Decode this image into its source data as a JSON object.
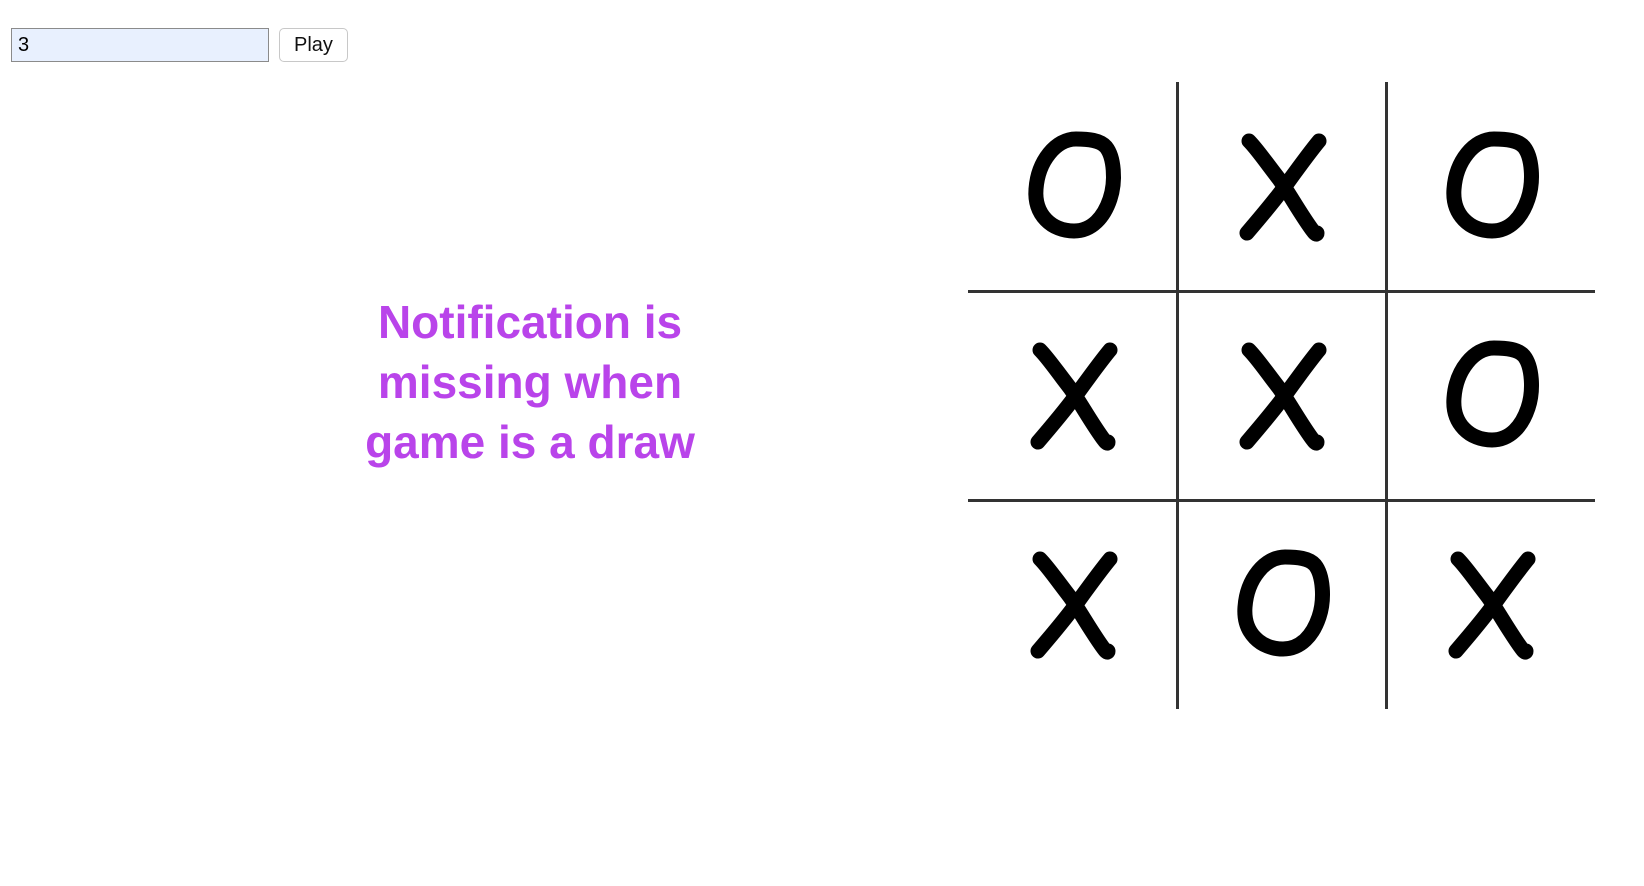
{
  "controls": {
    "size_value": "3",
    "play_label": "Play"
  },
  "message": {
    "text": "Notification is missing when game is a draw",
    "color": "#b944ea"
  },
  "board": {
    "size": 3,
    "cells": [
      [
        "O",
        "X",
        "O"
      ],
      [
        "X",
        "X",
        "O"
      ],
      [
        "X",
        "O",
        "X"
      ]
    ],
    "line_color": "#333333",
    "mark_color": "#000000"
  }
}
